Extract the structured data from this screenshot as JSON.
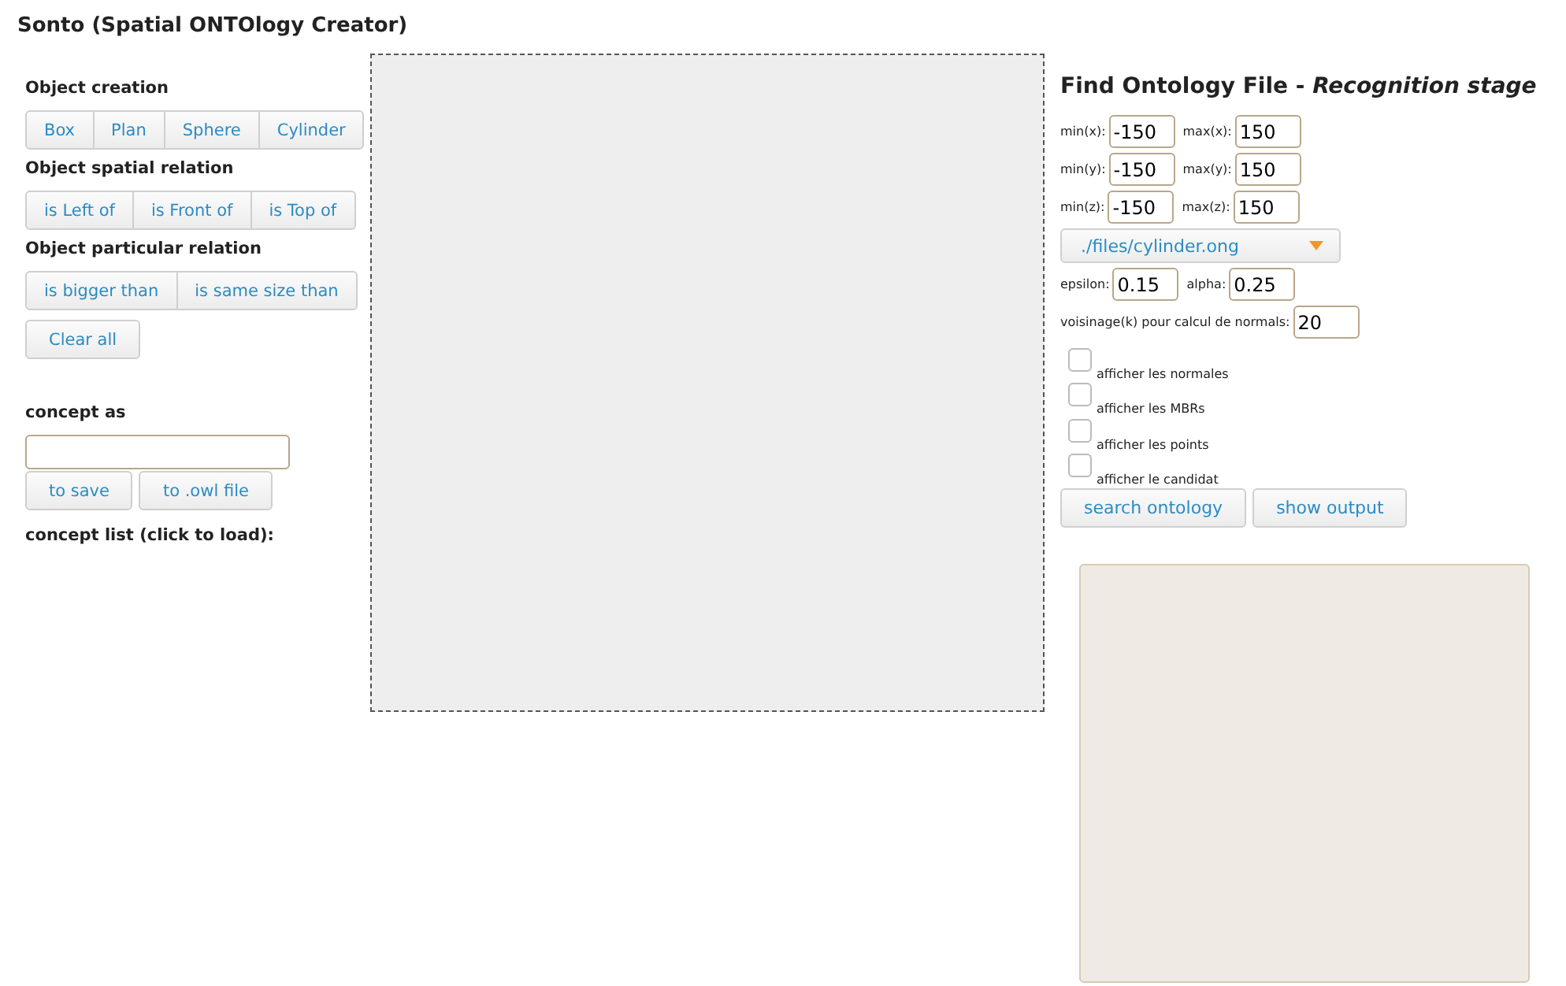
{
  "title": "Sonto (Spatial ONTOlogy Creator)",
  "object_creation": {
    "heading": "Object creation",
    "buttons": [
      "Box",
      "Plan",
      "Sphere",
      "Cylinder"
    ]
  },
  "spatial_relation": {
    "heading": "Object spatial relation",
    "buttons": [
      "is Left of",
      "is Front of",
      "is Top of"
    ]
  },
  "particular_relation": {
    "heading": "Object particular relation",
    "buttons": [
      "is bigger than",
      "is same size than"
    ]
  },
  "clear_button": "Clear all",
  "concept": {
    "heading": "concept as",
    "buttons": [
      "to save",
      "to .owl file"
    ]
  },
  "concept_list": {
    "heading": "concept list (click to load):"
  },
  "recognition": {
    "title": "Find Ontology File - *Recognition stage*",
    "ranges": [
      {
        "min_label": "min(x):",
        "min": "-150",
        "max_label": "max(x):",
        "max": "150"
      },
      {
        "min_label": "min(y):",
        "min": "-150",
        "max_label": "max(y):",
        "max": "150"
      },
      {
        "min_label": "min(z):",
        "min": "-150",
        "max_label": "max(z):",
        "max": "150"
      }
    ],
    "file_select": "./files/cylinder.ong",
    "params": [
      {
        "label": "epsilon:",
        "value": "0.15"
      },
      {
        "label": "alpha:",
        "value": "0.25"
      }
    ],
    "neighbourhood": {
      "label": "voisinage(k) pour calcul de normals:",
      "value": "20"
    },
    "options": [
      {
        "label": "afficher les normales",
        "checked": false
      },
      {
        "label": "afficher les MBRs",
        "checked": false
      },
      {
        "label": "afficher les points",
        "checked": false
      },
      {
        "label": "afficher le candidat",
        "checked": false
      }
    ],
    "buttons": [
      "search ontology",
      "show output"
    ]
  }
}
